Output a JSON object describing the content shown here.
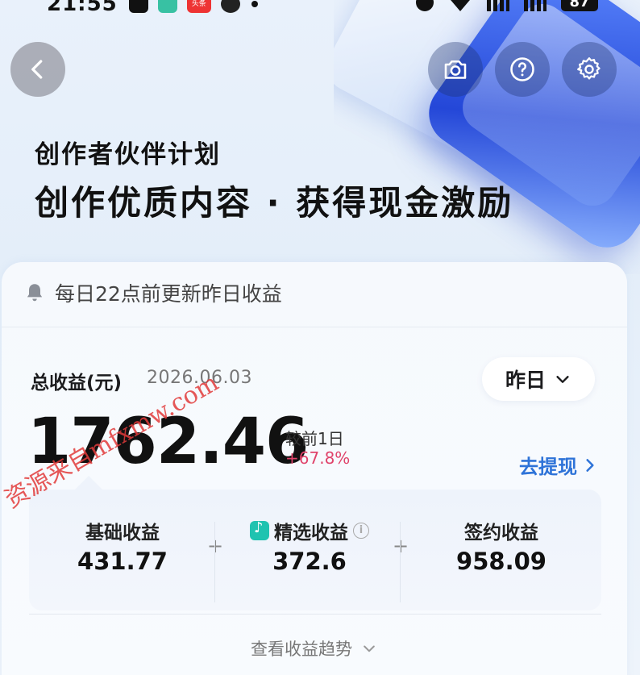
{
  "status_bar": {
    "time": "21:55",
    "app_badge": "头条",
    "battery": "87"
  },
  "header": {
    "back_icon": "chevron-left-icon",
    "actions": [
      "camera-icon",
      "help-icon",
      "gear-icon"
    ]
  },
  "hero": {
    "subtitle": "创作者伙伴计划",
    "title": "创作优质内容 · 获得现金激励"
  },
  "notice": {
    "text": "每日22点前更新昨日收益"
  },
  "earnings": {
    "label": "总收益(元)",
    "date": "2026.06.03",
    "period": "昨日",
    "total": "1762.46",
    "compare_label": "较前1日",
    "compare_value": "+67.8%",
    "withdraw": "去提现"
  },
  "breakdown": [
    {
      "label": "基础收益",
      "value": "431.77"
    },
    {
      "label": "精选收益",
      "value": "372.6"
    },
    {
      "label": "签约收益",
      "value": "958.09"
    }
  ],
  "footer": {
    "trend_link": "查看收益趋势"
  },
  "watermark": {
    "text": "资源来自mfxmw.com"
  },
  "colors": {
    "accent": "#2e73d8",
    "positive": "#e0436b",
    "hero_blue": "#2447d8"
  }
}
